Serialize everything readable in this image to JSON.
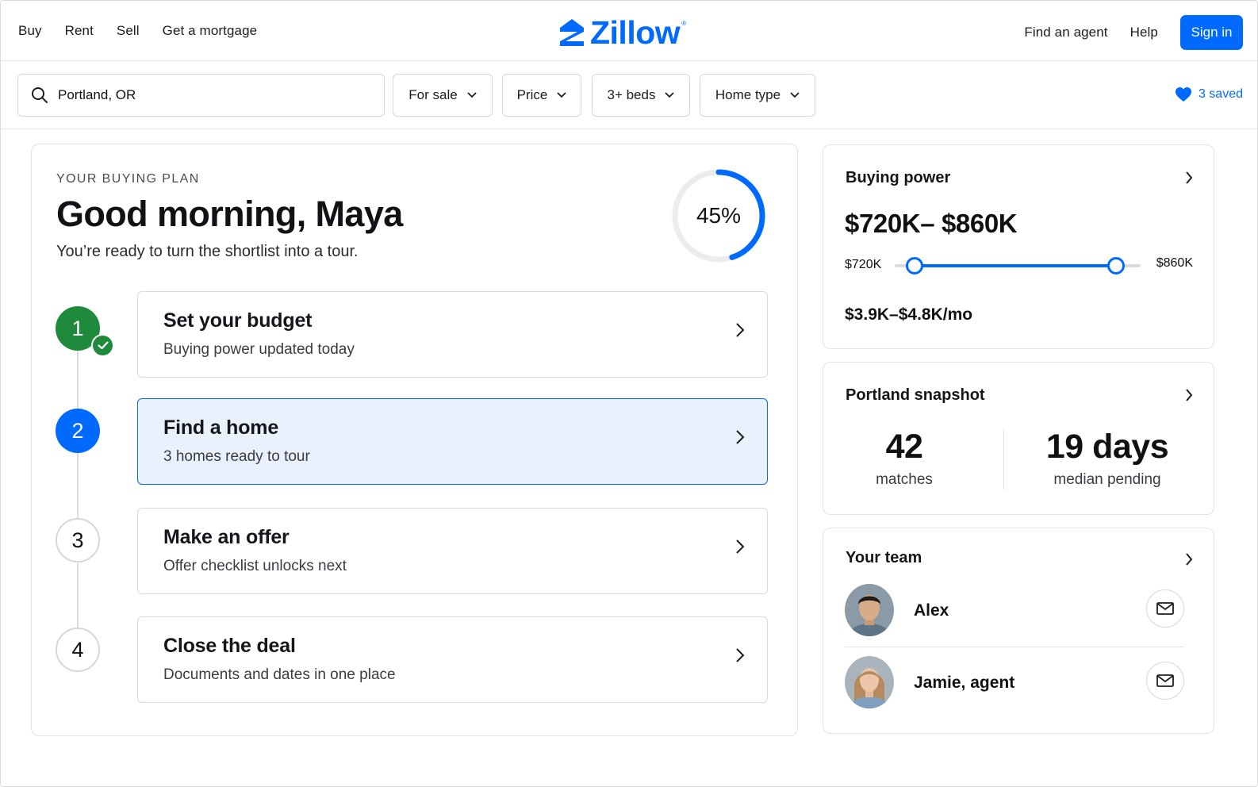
{
  "nav": {
    "left_links": [
      "Buy",
      "Rent",
      "Sell",
      "Get a mortgage"
    ],
    "logo": "Zillow",
    "right_links": [
      "Find an agent",
      "Help"
    ],
    "signin_label": "Sign in"
  },
  "filters": {
    "search_value": "Portland, OR",
    "buttons": [
      "For sale",
      "Price",
      "3+ beds",
      "Home type"
    ],
    "saved_label": "3 saved"
  },
  "plan": {
    "eyebrow": "YOUR BUYING PLAN",
    "greeting": "Good morning, Maya",
    "subtitle": "You’re ready to turn the shortlist into a tour.",
    "progress_label": "45%",
    "progress_value": 0.45,
    "steps": [
      {
        "number": "1",
        "title": "Set your budget",
        "desc": "Buying power updated today",
        "status": "done"
      },
      {
        "number": "2",
        "title": "Find a home",
        "desc": "3 homes ready to tour",
        "status": "active"
      },
      {
        "number": "3",
        "title": "Make an offer",
        "desc": "Offer checklist unlocks next",
        "status": "todo"
      },
      {
        "number": "4",
        "title": "Close the deal",
        "desc": "Documents and dates in one place",
        "status": "todo"
      }
    ]
  },
  "buying_power": {
    "title": "Buying power",
    "range": "$720K– $860K",
    "min_label": "$720K",
    "max_label": "$860K",
    "range_low_fraction": 0.08,
    "range_high_fraction": 0.9,
    "monthly": "$3.9K–$4.8K/mo"
  },
  "snapshot": {
    "title": "Portland snapshot",
    "stat1_value": "42",
    "stat1_label": "matches",
    "stat2_value": "19 days",
    "stat2_label": "median pending"
  },
  "team": {
    "title": "Your team",
    "members": [
      {
        "name": "Alex"
      },
      {
        "name": "Jamie, agent"
      }
    ]
  },
  "colors": {
    "brand": "#006aff",
    "done": "#1f8a3b",
    "active_bg": "#e9f1fd"
  }
}
